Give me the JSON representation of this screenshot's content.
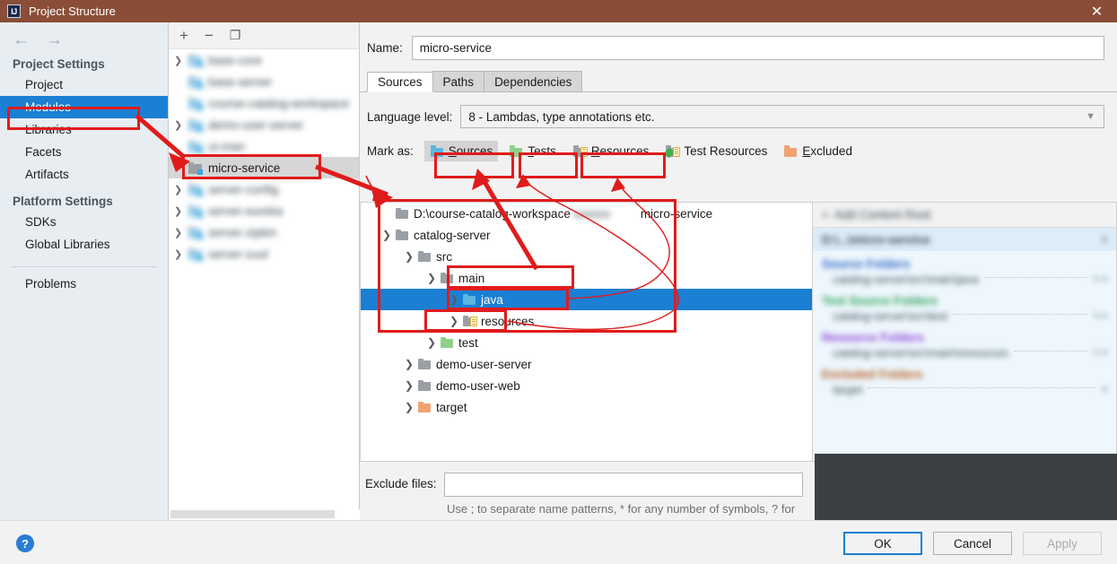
{
  "titlebar": {
    "title": "Project Structure",
    "logo": "IJ",
    "close": "✕"
  },
  "sidebar": {
    "back_icon": "←",
    "forward_icon": "→",
    "groups": [
      {
        "title": "Project Settings",
        "items": [
          {
            "label": "Project",
            "selected": false
          },
          {
            "label": "Modules",
            "selected": true
          },
          {
            "label": "Libraries",
            "selected": false
          },
          {
            "label": "Facets",
            "selected": false
          },
          {
            "label": "Artifacts",
            "selected": false
          }
        ]
      },
      {
        "title": "Platform Settings",
        "items": [
          {
            "label": "SDKs",
            "selected": false
          },
          {
            "label": "Global Libraries",
            "selected": false
          }
        ]
      }
    ],
    "problems_label": "Problems"
  },
  "module_toolbar": {
    "add": "+",
    "remove": "−",
    "copy": "❐"
  },
  "module_list": [
    {
      "label": "base-core",
      "blurred": true,
      "chevron": true,
      "selected": false
    },
    {
      "label": "base-server",
      "blurred": true,
      "chevron": false,
      "selected": false
    },
    {
      "label": "course-catalog-workspace",
      "blurred": true,
      "chevron": false,
      "selected": false
    },
    {
      "label": "demo-user-server",
      "blurred": true,
      "chevron": true,
      "selected": false
    },
    {
      "label": "ui-man",
      "blurred": true,
      "chevron": false,
      "selected": false
    },
    {
      "label": "micro-service",
      "blurred": false,
      "chevron": false,
      "selected": true
    },
    {
      "label": "server-config",
      "blurred": true,
      "chevron": true,
      "selected": false
    },
    {
      "label": "server-eureka",
      "blurred": true,
      "chevron": true,
      "selected": false
    },
    {
      "label": "server-zipkin",
      "blurred": true,
      "chevron": true,
      "selected": false
    },
    {
      "label": "server-zuul",
      "blurred": true,
      "chevron": true,
      "selected": false
    }
  ],
  "main": {
    "name_label": "Name:",
    "name_value": "micro-service",
    "tabs": [
      {
        "label": "Sources",
        "active": true
      },
      {
        "label": "Paths",
        "active": false
      },
      {
        "label": "Dependencies",
        "active": false
      }
    ],
    "language_level_label": "Language level:",
    "language_level_value": "8 - Lambdas, type annotations etc.",
    "language_level_chevron": "⌄",
    "mark_as_label": "Mark as:",
    "mark_buttons": [
      {
        "label": "Sources",
        "mnemonic": "S",
        "icon": "folder-blue-icon",
        "pressed": true
      },
      {
        "label": "Tests",
        "mnemonic": "T",
        "icon": "folder-green-icon",
        "pressed": false
      },
      {
        "label": "Resources",
        "mnemonic": "R",
        "icon": "folder-resources-icon",
        "pressed": false
      },
      {
        "label": "Test Resources",
        "mnemonic": "",
        "icon": "folder-test-resources-icon",
        "pressed": false
      },
      {
        "label": "Excluded",
        "mnemonic": "E",
        "icon": "folder-orange-icon",
        "pressed": false
      }
    ]
  },
  "tree": [
    {
      "label": "D:\\course-catalog-workspace\\           \\micro-service",
      "indent": 0,
      "chevron": "none",
      "icon": "gray",
      "selected": false,
      "partial_blur": true
    },
    {
      "label": "catalog-server",
      "indent": 1,
      "chevron": "down",
      "icon": "gray",
      "selected": false
    },
    {
      "label": "src",
      "indent": 2,
      "chevron": "down",
      "icon": "gray",
      "selected": false
    },
    {
      "label": "main",
      "indent": 3,
      "chevron": "down",
      "icon": "gray",
      "selected": false
    },
    {
      "label": "java",
      "indent": 4,
      "chevron": "right",
      "icon": "blue",
      "selected": true
    },
    {
      "label": "resources",
      "indent": 4,
      "chevron": "right",
      "icon": "resources",
      "selected": false
    },
    {
      "label": "test",
      "indent": 3,
      "chevron": "right",
      "icon": "green",
      "selected": false
    },
    {
      "label": "demo-user-server",
      "indent": 2,
      "chevron": "right",
      "icon": "gray",
      "selected": false
    },
    {
      "label": "demo-user-web",
      "indent": 2,
      "chevron": "right",
      "icon": "gray",
      "selected": false
    },
    {
      "label": "target",
      "indent": 2,
      "chevron": "right",
      "icon": "orange",
      "selected": false
    }
  ],
  "right_info": {
    "add_content_root": "Add Content Root",
    "content_root_path": "D:\\...\\micro-service",
    "sections": [
      {
        "kind": "src",
        "title": "Source Folders",
        "paths": [
          "catalog-server\\src\\main\\java"
        ]
      },
      {
        "kind": "test",
        "title": "Test Source Folders",
        "paths": [
          "catalog-server\\src\\test"
        ]
      },
      {
        "kind": "res",
        "title": "Resource Folders",
        "paths": [
          "catalog-server\\src\\main\\resources"
        ]
      },
      {
        "kind": "exc",
        "title": "Excluded Folders",
        "paths": [
          "target"
        ]
      }
    ],
    "edit_icon": "✎",
    "remove_icon": "✕",
    "plus_icon": "+"
  },
  "exclude": {
    "label": "Exclude files:",
    "value": "",
    "hint": "Use ; to separate name patterns, * for any number of symbols, ? for one."
  },
  "bottom": {
    "help": "?",
    "ok": "OK",
    "cancel": "Cancel",
    "apply": "Apply"
  },
  "colors": {
    "titlebar": "#8a4e38",
    "selection": "#1b7fd4",
    "annotation": "#e01b1b",
    "sidebar_bg": "#e8edf2",
    "source_blue": "#2a62c4",
    "test_green": "#2a9e53",
    "resource_purple": "#8a3fd4",
    "excluded_brown": "#b4591f"
  }
}
